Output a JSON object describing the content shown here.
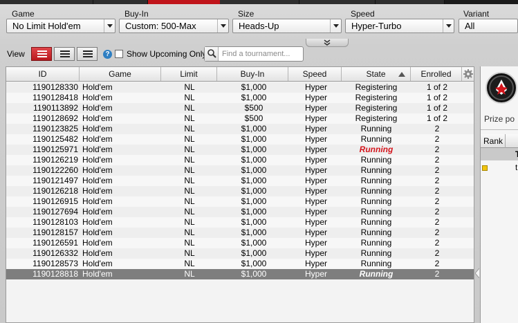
{
  "filters": {
    "game": {
      "label": "Game",
      "value": "No Limit Hold'em"
    },
    "buyin": {
      "label": "Buy-In",
      "value": "Custom: 500-Max"
    },
    "size": {
      "label": "Size",
      "value": "Heads-Up"
    },
    "speed": {
      "label": "Speed",
      "value": "Hyper-Turbo"
    },
    "variant": {
      "label": "Variant",
      "value": "All"
    }
  },
  "toolbar": {
    "view_label": "View",
    "show_upcoming_label": "Show Upcoming Only",
    "show_upcoming_checked": false,
    "search_placeholder": "Find a tournament..."
  },
  "grid": {
    "columns": [
      "ID",
      "Game",
      "Limit",
      "Buy-In",
      "Speed",
      "State",
      "Enrolled"
    ],
    "sorted_column": "State",
    "rows": [
      {
        "id": "1190128330",
        "game": "Hold'em",
        "limit": "NL",
        "buyin": "$1,000",
        "speed": "Hyper",
        "state": "Registering",
        "enrolled": "1 of 2"
      },
      {
        "id": "1190128418",
        "game": "Hold'em",
        "limit": "NL",
        "buyin": "$1,000",
        "speed": "Hyper",
        "state": "Registering",
        "enrolled": "1 of 2"
      },
      {
        "id": "1190113892",
        "game": "Hold'em",
        "limit": "NL",
        "buyin": "$500",
        "speed": "Hyper",
        "state": "Registering",
        "enrolled": "1 of 2"
      },
      {
        "id": "1190128692",
        "game": "Hold'em",
        "limit": "NL",
        "buyin": "$500",
        "speed": "Hyper",
        "state": "Registering",
        "enrolled": "1 of 2"
      },
      {
        "id": "1190123825",
        "game": "Hold'em",
        "limit": "NL",
        "buyin": "$1,000",
        "speed": "Hyper",
        "state": "Running",
        "enrolled": "2"
      },
      {
        "id": "1190125482",
        "game": "Hold'em",
        "limit": "NL",
        "buyin": "$1,000",
        "speed": "Hyper",
        "state": "Running",
        "enrolled": "2"
      },
      {
        "id": "1190125971",
        "game": "Hold'em",
        "limit": "NL",
        "buyin": "$1,000",
        "speed": "Hyper",
        "state": "Running",
        "enrolled": "2",
        "highlight": true
      },
      {
        "id": "1190126219",
        "game": "Hold'em",
        "limit": "NL",
        "buyin": "$1,000",
        "speed": "Hyper",
        "state": "Running",
        "enrolled": "2"
      },
      {
        "id": "1190122260",
        "game": "Hold'em",
        "limit": "NL",
        "buyin": "$1,000",
        "speed": "Hyper",
        "state": "Running",
        "enrolled": "2"
      },
      {
        "id": "1190121497",
        "game": "Hold'em",
        "limit": "NL",
        "buyin": "$1,000",
        "speed": "Hyper",
        "state": "Running",
        "enrolled": "2"
      },
      {
        "id": "1190126218",
        "game": "Hold'em",
        "limit": "NL",
        "buyin": "$1,000",
        "speed": "Hyper",
        "state": "Running",
        "enrolled": "2"
      },
      {
        "id": "1190126915",
        "game": "Hold'em",
        "limit": "NL",
        "buyin": "$1,000",
        "speed": "Hyper",
        "state": "Running",
        "enrolled": "2"
      },
      {
        "id": "1190127694",
        "game": "Hold'em",
        "limit": "NL",
        "buyin": "$1,000",
        "speed": "Hyper",
        "state": "Running",
        "enrolled": "2"
      },
      {
        "id": "1190128103",
        "game": "Hold'em",
        "limit": "NL",
        "buyin": "$1,000",
        "speed": "Hyper",
        "state": "Running",
        "enrolled": "2"
      },
      {
        "id": "1190128157",
        "game": "Hold'em",
        "limit": "NL",
        "buyin": "$1,000",
        "speed": "Hyper",
        "state": "Running",
        "enrolled": "2"
      },
      {
        "id": "1190126591",
        "game": "Hold'em",
        "limit": "NL",
        "buyin": "$1,000",
        "speed": "Hyper",
        "state": "Running",
        "enrolled": "2"
      },
      {
        "id": "1190126332",
        "game": "Hold'em",
        "limit": "NL",
        "buyin": "$1,000",
        "speed": "Hyper",
        "state": "Running",
        "enrolled": "2"
      },
      {
        "id": "1190128573",
        "game": "Hold'em",
        "limit": "NL",
        "buyin": "$1,000",
        "speed": "Hyper",
        "state": "Running",
        "enrolled": "2"
      },
      {
        "id": "1190128818",
        "game": "Hold'em",
        "limit": "NL",
        "buyin": "$1,000",
        "speed": "Hyper",
        "state": "Running",
        "enrolled": "2",
        "selected": true
      }
    ]
  },
  "right_panel": {
    "prize_label": "Prize po",
    "rank_header": "Rank",
    "row_top": "T",
    "row_cut": "t"
  },
  "colors": {
    "accent_red": "#d4151c",
    "selected_row": "#7e7e7e",
    "help_blue": "#2f7fc2"
  }
}
